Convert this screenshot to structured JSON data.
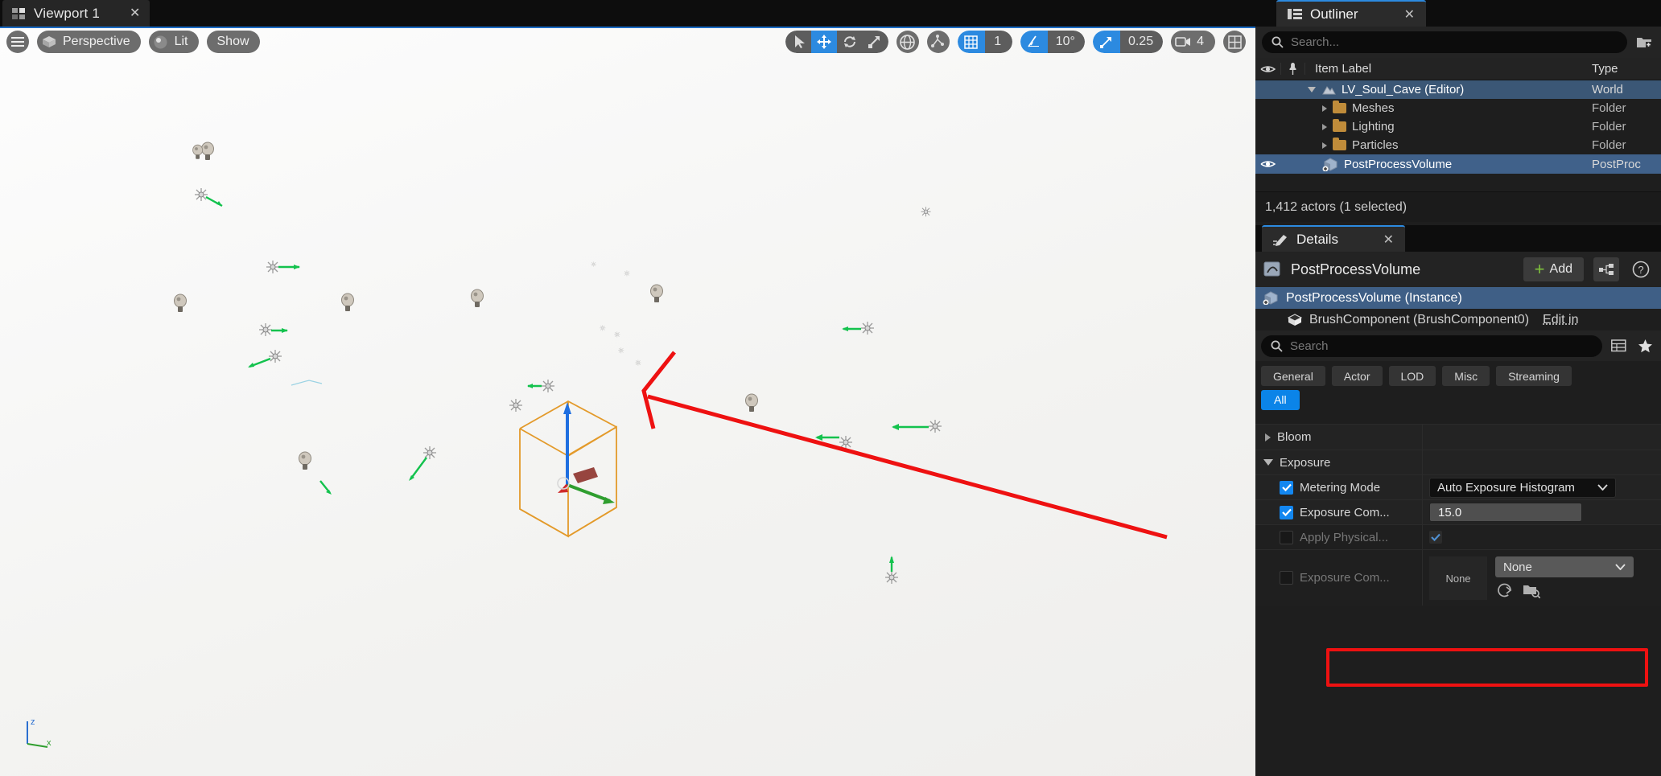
{
  "viewport": {
    "tab": {
      "label": "Viewport 1",
      "close": "✕",
      "icon": "viewport-grid-icon"
    },
    "toolbar": {
      "menu_icon": "hamburger-menu-icon",
      "camera_mode": "Perspective",
      "view_mode": "Lit",
      "show_menu": "Show",
      "transform_tools": [
        "select-icon",
        "move-icon",
        "rotate-icon",
        "scale-icon"
      ],
      "active_transform_tool": "move-icon",
      "coordinate_system": "world-globe-icon",
      "surface_snap": "surface-snap-icon",
      "grid_snap": {
        "icon": "grid-snap-icon",
        "value": "1",
        "enabled": true
      },
      "angle_snap": {
        "icon": "angle-snap-icon",
        "value": "10°",
        "enabled": true
      },
      "scale_snap": {
        "icon": "scale-snap-icon",
        "value": "0.25",
        "enabled": true
      },
      "camera_speed": {
        "icon": "camera-icon",
        "value": "4"
      },
      "layout_icon": "viewport-layout-icon"
    },
    "axis_widget": {
      "z": "z",
      "x": "x"
    }
  },
  "outliner": {
    "tab": {
      "label": "Outliner",
      "close": "✕",
      "icon": "outliner-icon"
    },
    "search": {
      "placeholder": "Search...",
      "value": "",
      "icon": "search-icon"
    },
    "create_folder_icon": "new-folder-icon",
    "columns": {
      "eye": "visibility-icon",
      "pin": "pin-icon",
      "item_label": "Item Label",
      "type": "Type"
    },
    "rows": [
      {
        "label": "LV_Soul_Cave (Editor)",
        "type": "World",
        "icon": "world-icon",
        "depth": 0,
        "expanded": true,
        "selected": true,
        "eye": false
      },
      {
        "label": "Meshes",
        "type": "Folder",
        "icon": "folder-icon",
        "depth": 1,
        "expanded": false,
        "selected": false,
        "eye": false
      },
      {
        "label": "Lighting",
        "type": "Folder",
        "icon": "folder-icon",
        "depth": 1,
        "expanded": false,
        "selected": false,
        "eye": false
      },
      {
        "label": "Particles",
        "type": "Folder",
        "icon": "folder-icon",
        "depth": 1,
        "expanded": false,
        "selected": false,
        "eye": false
      },
      {
        "label": "PostProcessVolume",
        "type": "PostProc",
        "icon": "volume-icon",
        "depth": 1,
        "expanded": false,
        "selected": true,
        "eye": true
      }
    ],
    "status": "1,412 actors (1 selected)"
  },
  "details": {
    "tab": {
      "label": "Details",
      "close": "✕",
      "icon": "details-pencil-icon"
    },
    "header": {
      "title": "PostProcessVolume",
      "icon": "postprocess-icon",
      "add_label": "Add",
      "add_icon": "plus-icon",
      "blueprint_icon": "blueprint-icon",
      "help_icon": "help-icon"
    },
    "instance_row": {
      "label": "PostProcessVolume (Instance)",
      "icon": "volume-icon"
    },
    "component_row": {
      "label": "BrushComponent (BrushComponent0)",
      "icon": "mesh-icon",
      "edit_link": "Edit in"
    },
    "search": {
      "placeholder": "Search",
      "value": "",
      "icon": "search-icon",
      "table_icon": "columns-icon",
      "favorite_icon": "star-icon"
    },
    "filters": [
      "General",
      "Actor",
      "LOD",
      "Misc",
      "Streaming"
    ],
    "filters_row2": [
      {
        "label": "All",
        "active": true
      }
    ],
    "properties": [
      {
        "name": "Bloom",
        "kind": "category",
        "expanded": false
      },
      {
        "name": "Exposure",
        "kind": "category",
        "expanded": true
      },
      {
        "name": "Metering Mode",
        "kind": "combo",
        "checked": true,
        "value": "Auto Exposure Histogram",
        "enabled": true
      },
      {
        "name": "Exposure Com...",
        "kind": "number",
        "checked": true,
        "value": "15.0",
        "enabled": true,
        "highlighted": true
      },
      {
        "name": "Apply Physical...",
        "kind": "checkbox",
        "checked": false,
        "value_checked": true,
        "enabled": false
      },
      {
        "name": "Exposure Com...",
        "kind": "asset",
        "checked": false,
        "value": "None",
        "thumb": "None",
        "enabled": false,
        "reset_icon": "reset-arrow-icon",
        "browse_icon": "browse-folder-icon"
      }
    ]
  },
  "annotation": {
    "arrow_color": "#ee1111",
    "highlight_color": "#ee1111"
  }
}
